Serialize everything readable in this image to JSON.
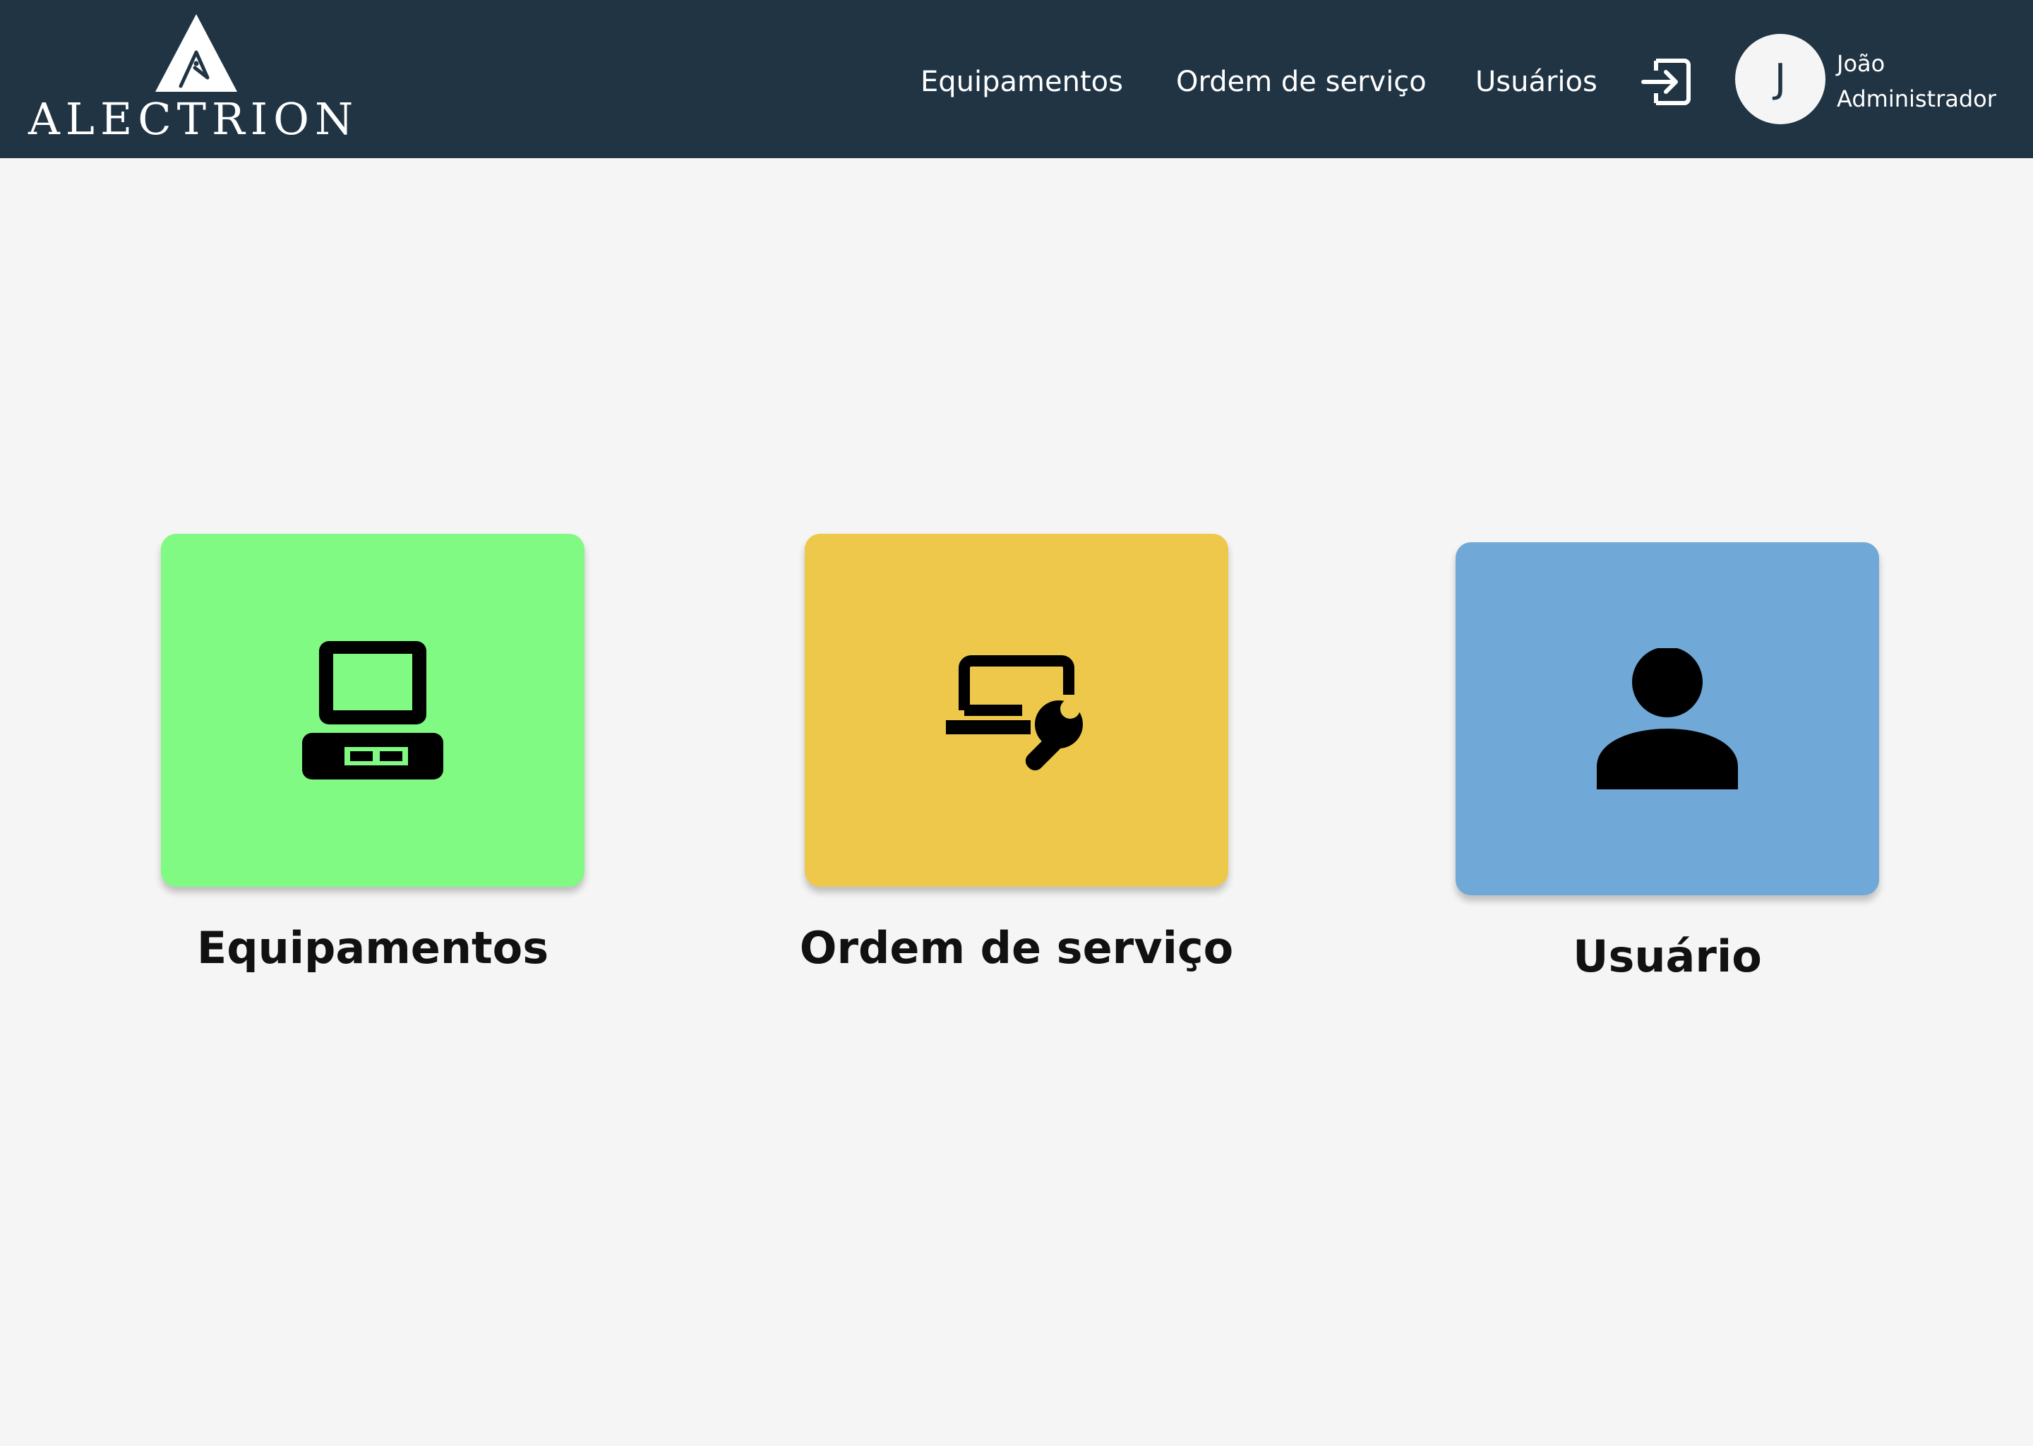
{
  "header": {
    "brand": "ALECTRION",
    "nav": [
      {
        "label": "Equipamentos"
      },
      {
        "label": "Ordem de serviço"
      },
      {
        "label": "Usuários"
      }
    ],
    "user": {
      "initial": "J",
      "name": "João",
      "role": "Administrador"
    },
    "icons": {
      "logout": "logout-icon",
      "logo": "alectrion-logo"
    }
  },
  "cards": [
    {
      "label": "Equipamentos",
      "color": "#80fa82",
      "icon": "computer-icon"
    },
    {
      "label": "Ordem de serviço",
      "color": "#edc84b",
      "icon": "laptop-wrench-icon"
    },
    {
      "label": "Usuário",
      "color": "#70a9d8",
      "icon": "person-icon"
    }
  ],
  "colors": {
    "header_bg": "#203444",
    "page_bg": "#f5f5f5"
  }
}
